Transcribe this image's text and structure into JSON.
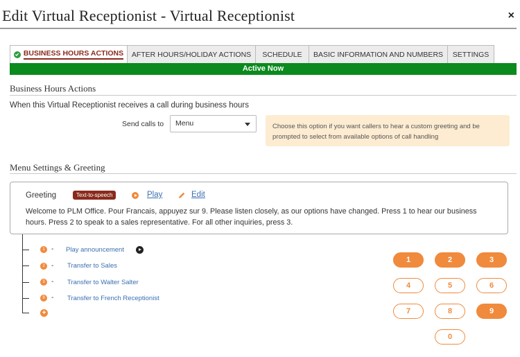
{
  "dialog": {
    "title": "Edit Virtual Receptionist - Virtual Receptionist",
    "close_label": "×"
  },
  "tabs": [
    {
      "label": "BUSINESS HOURS ACTIONS",
      "active": true
    },
    {
      "label": "AFTER HOURS/HOLIDAY ACTIONS",
      "active": false
    },
    {
      "label": "SCHEDULE",
      "active": false
    },
    {
      "label": "BASIC INFORMATION AND NUMBERS",
      "active": false
    },
    {
      "label": "SETTINGS",
      "active": false
    }
  ],
  "status_bar": {
    "label": "Active Now",
    "color": "#0b8a1d"
  },
  "business_hours": {
    "heading": "Business Hours Actions",
    "intro": "When this Virtual Receptionist receives a call during business hours",
    "send_calls_label": "Send calls to",
    "send_calls_value": "Menu",
    "hint": "Choose this option if you want callers to hear a custom greeting and be prompted to select from available options of call handling"
  },
  "menu_settings": {
    "heading": "Menu Settings & Greeting",
    "greeting_label": "Greeting",
    "greeting_type_badge": "Text-to-speech",
    "play_label": "Play",
    "edit_label": "Edit",
    "greeting_text": "Welcome to PLM Office. Pour Francais, appuyez sur 9. Please listen closely, as our options have changed. Press 1 to hear our business hours. Press 2 to speak to a sales representative. For all other inquiries, press 3."
  },
  "menu_options": [
    {
      "key": "1",
      "dash": "-",
      "label": "Play announcement",
      "has_play": true
    },
    {
      "key": "2",
      "dash": "-",
      "label": "Transfer to Sales",
      "has_play": false
    },
    {
      "key": "3",
      "dash": "-",
      "label": "Transfer to Walter Salter",
      "has_play": false
    },
    {
      "key": "9",
      "dash": "-",
      "label": "Transfer to French Receptionist",
      "has_play": false
    }
  ],
  "add_option_label": "+",
  "keypad": [
    {
      "label": "1",
      "assigned": true
    },
    {
      "label": "2",
      "assigned": true
    },
    {
      "label": "3",
      "assigned": true
    },
    {
      "label": "4",
      "assigned": false
    },
    {
      "label": "5",
      "assigned": false
    },
    {
      "label": "6",
      "assigned": false
    },
    {
      "label": "7",
      "assigned": false
    },
    {
      "label": "8",
      "assigned": false
    },
    {
      "label": "9",
      "assigned": true
    },
    {
      "label": "0",
      "assigned": false
    }
  ],
  "colors": {
    "accent": "#f08a3c",
    "brand": "#8a2a1c",
    "link": "#3a6fb0",
    "hint_bg": "#fdecd1"
  }
}
